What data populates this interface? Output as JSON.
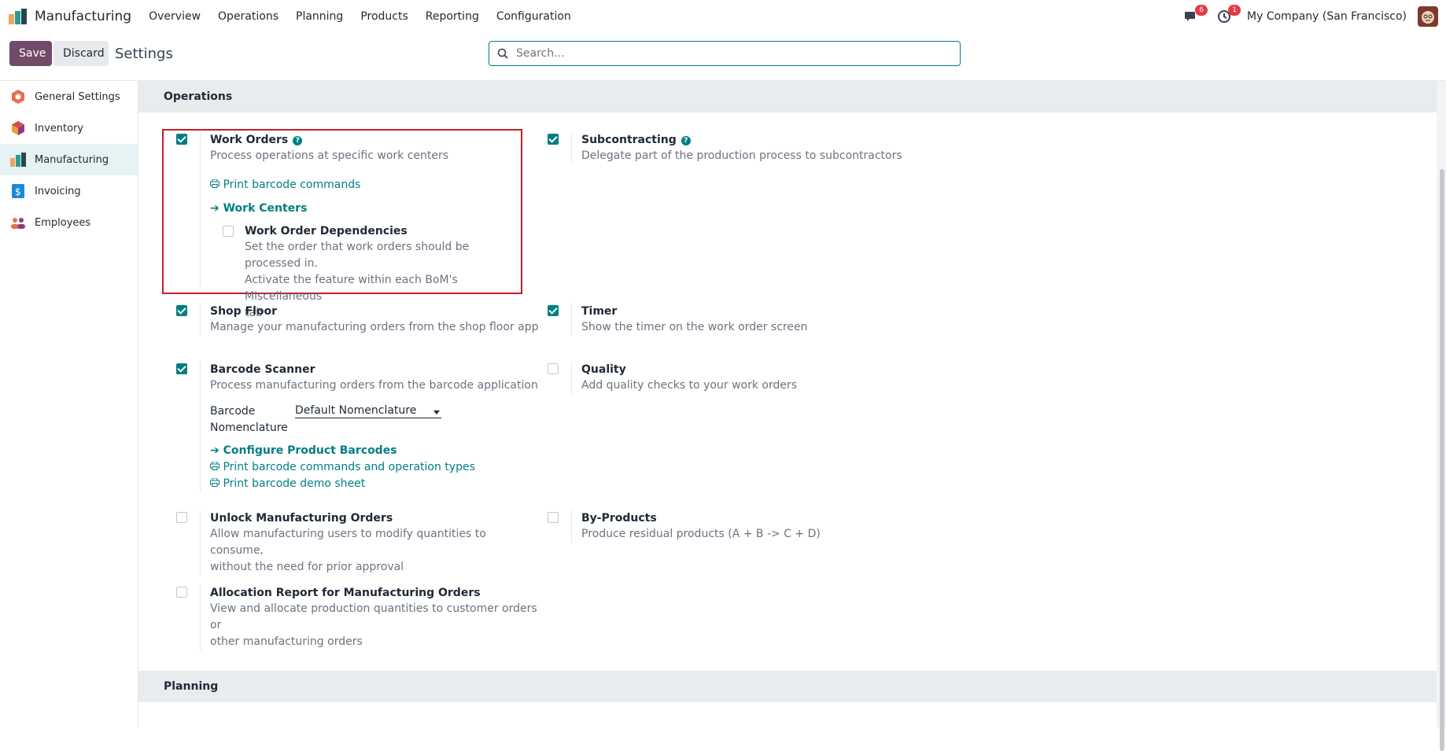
{
  "app": {
    "name": "Manufacturing"
  },
  "menu": [
    "Overview",
    "Operations",
    "Planning",
    "Products",
    "Reporting",
    "Configuration"
  ],
  "systray": {
    "messages_badge": "6",
    "activity_badge": "1",
    "company": "My Company (San Francisco)"
  },
  "control": {
    "save_label": "Save",
    "discard_label": "Discard",
    "breadcrumb": "Settings",
    "search_placeholder": "Search..."
  },
  "sidebar": {
    "items": [
      {
        "label": "General Settings",
        "icon": "general-settings-icon"
      },
      {
        "label": "Inventory",
        "icon": "inventory-icon"
      },
      {
        "label": "Manufacturing",
        "icon": "manufacturing-icon"
      },
      {
        "label": "Invoicing",
        "icon": "invoicing-icon"
      },
      {
        "label": "Employees",
        "icon": "employees-icon"
      }
    ]
  },
  "sections": {
    "operations": "Operations",
    "planning": "Planning"
  },
  "settings": {
    "work_orders": {
      "title": "Work Orders",
      "desc": "Process operations at specific work centers",
      "checked": true,
      "link_print": "Print barcode commands",
      "link_centers": "Work Centers",
      "dep_title": "Work Order Dependencies",
      "dep_desc1": "Set the order that work orders should be processed in.",
      "dep_desc2": "Activate the feature within each BoM's Miscellaneous",
      "dep_desc3": "tab"
    },
    "subcontracting": {
      "title": "Subcontracting",
      "desc": "Delegate part of the production process to subcontractors",
      "checked": true
    },
    "shop_floor": {
      "title": "Shop Floor",
      "desc": "Manage your manufacturing orders from the shop floor app",
      "checked": true
    },
    "timer": {
      "title": "Timer",
      "desc": "Show the timer on the work order screen",
      "checked": true
    },
    "barcode": {
      "title": "Barcode Scanner",
      "desc": "Process manufacturing orders from the barcode application",
      "checked": true,
      "nomen_label1": "Barcode",
      "nomen_label2": "Nomenclature",
      "nomen_value": "Default Nomenclature",
      "link_config": "Configure Product Barcodes",
      "link_print_ops": "Print barcode commands and operation types",
      "link_demo": "Print barcode demo sheet"
    },
    "quality": {
      "title": "Quality",
      "desc": "Add quality checks to your work orders",
      "checked": false
    },
    "unlock": {
      "title": "Unlock Manufacturing Orders",
      "desc1": "Allow manufacturing users to modify quantities to consume,",
      "desc2": "without the need for prior approval",
      "checked": false
    },
    "byproducts": {
      "title": "By-Products",
      "desc": "Produce residual products (A + B -> C + D)",
      "checked": false
    },
    "allocation": {
      "title": "Allocation Report for Manufacturing Orders",
      "desc1": "View and allocate production quantities to customer orders or",
      "desc2": "other manufacturing orders",
      "checked": false
    }
  },
  "colors": {
    "primary": "#714b67",
    "accent": "#017e84",
    "highlight": "#c0202a"
  }
}
